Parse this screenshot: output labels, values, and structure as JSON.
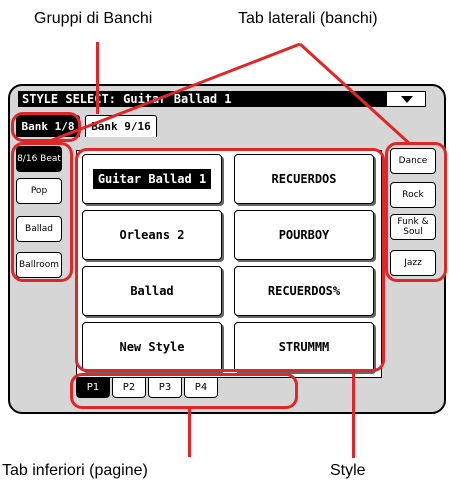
{
  "annotations": {
    "top_left": "Gruppi di Banchi",
    "top_right": "Tab laterali (banchi)",
    "bottom_left": "Tab inferiori (pagine)",
    "bottom_right": "Style"
  },
  "screen": {
    "title": "STYLE SELECT: Guitar Ballad 1",
    "banks": [
      "Bank 1/8",
      "Bank 9/16"
    ],
    "left_tabs": [
      "8/16 Beat",
      "Pop",
      "Ballad",
      "Ballroom"
    ],
    "right_tabs": [
      "Dance",
      "Rock",
      "Funk & Soul",
      "Jazz"
    ],
    "styles": [
      "Guitar Ballad 1",
      "RECUERDOS",
      "Orleans 2",
      "POURBOY",
      "Ballad",
      "RECUERDOS%",
      "New Style",
      "STRUMMM"
    ],
    "pages": [
      "P1",
      "P2",
      "P3",
      "P4"
    ]
  },
  "colors": {
    "callout": "#e02626",
    "screen_bg": "#d6d6d6"
  }
}
